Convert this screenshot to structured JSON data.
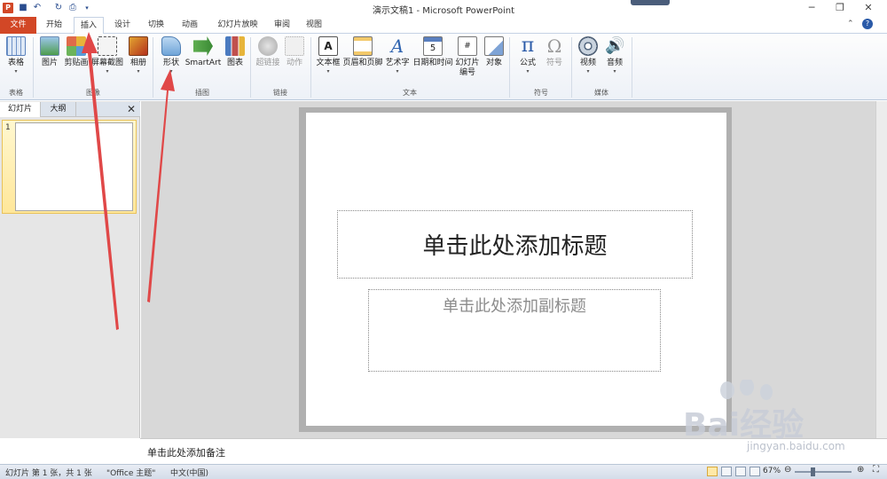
{
  "window": {
    "title": "演示文稿1 - Microsoft PowerPoint"
  },
  "tabs": [
    {
      "label": "文件"
    },
    {
      "label": "开始"
    },
    {
      "label": "插入"
    },
    {
      "label": "设计"
    },
    {
      "label": "切换"
    },
    {
      "label": "动画"
    },
    {
      "label": "幻灯片放映"
    },
    {
      "label": "审阅"
    },
    {
      "label": "视图"
    }
  ],
  "ribbon": {
    "buttons": [
      {
        "label": "表格",
        "icon": "table-icon"
      },
      {
        "label": "图片",
        "icon": "picture-icon"
      },
      {
        "label": "剪贴画",
        "icon": "clipart-icon"
      },
      {
        "label": "屏幕截图",
        "icon": "screenshot-icon"
      },
      {
        "label": "相册",
        "icon": "album-icon"
      },
      {
        "label": "形状",
        "icon": "shapes-icon"
      },
      {
        "label": "SmartArt",
        "icon": "smartart-icon"
      },
      {
        "label": "图表",
        "icon": "chart-icon"
      },
      {
        "label": "超链接",
        "icon": "hyperlink-icon"
      },
      {
        "label": "动作",
        "icon": "action-icon"
      },
      {
        "label": "文本框",
        "icon": "textbox-icon"
      },
      {
        "label": "页眉和页脚",
        "icon": "header-footer-icon"
      },
      {
        "label": "艺术字",
        "icon": "wordart-icon"
      },
      {
        "label": "日期和时间",
        "icon": "datetime-icon"
      },
      {
        "label": "幻灯片",
        "label2": "编号",
        "icon": "slide-number-icon"
      },
      {
        "label": "对象",
        "icon": "object-icon"
      },
      {
        "label": "公式",
        "icon": "equation-icon"
      },
      {
        "label": "符号",
        "icon": "symbol-icon"
      },
      {
        "label": "视频",
        "icon": "video-icon"
      },
      {
        "label": "音频",
        "icon": "audio-icon"
      }
    ],
    "groups": [
      "表格",
      "图像",
      "插图",
      "链接",
      "文本",
      "符号",
      "媒体"
    ]
  },
  "pane": {
    "tabs": [
      "幻灯片",
      "大纲"
    ],
    "slide_number": "1"
  },
  "slide": {
    "title_placeholder": "单击此处添加标题",
    "subtitle_placeholder": "单击此处添加副标题"
  },
  "notes": {
    "placeholder": "单击此处添加备注"
  },
  "status": {
    "slide_info": "幻灯片 第 1 张，共 1 张",
    "theme": "\"Office 主题\"",
    "language": "中文(中国)",
    "zoom": "67%"
  },
  "watermark": {
    "text": "Bai经验",
    "url": "jingyan.baidu.com"
  },
  "colors": {
    "file_tab": "#d24726",
    "arrow": "#e04848",
    "accent": "#2a5aa8"
  }
}
